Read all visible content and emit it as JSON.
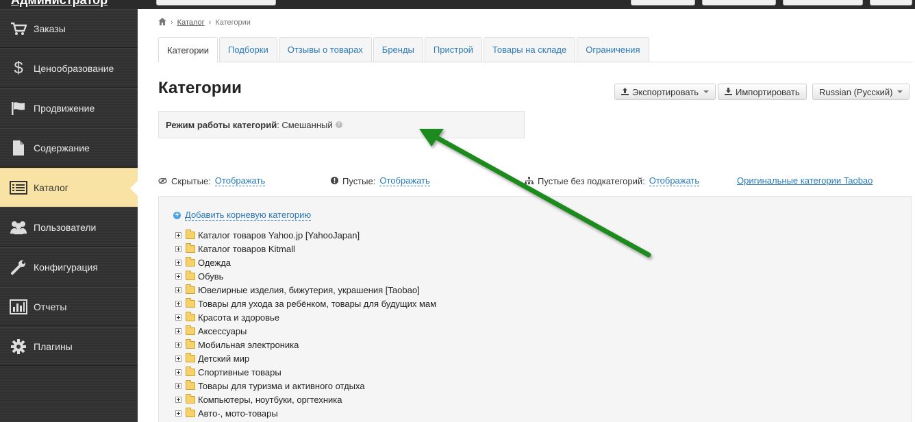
{
  "topbar": {
    "logo": "Администратор"
  },
  "sidebar": {
    "items": [
      {
        "label": "Заказы",
        "icon": "cart-icon"
      },
      {
        "label": "Ценообразование",
        "icon": "dollar-icon"
      },
      {
        "label": "Продвижение",
        "icon": "flag-icon"
      },
      {
        "label": "Содержание",
        "icon": "document-icon"
      },
      {
        "label": "Каталог",
        "icon": "list-icon",
        "active": true
      },
      {
        "label": "Пользователи",
        "icon": "users-icon"
      },
      {
        "label": "Конфигурация",
        "icon": "wrench-icon"
      },
      {
        "label": "Отчеты",
        "icon": "bar-chart-icon"
      },
      {
        "label": "Плагины",
        "icon": "gear-icon"
      }
    ]
  },
  "breadcrumb": {
    "home_icon": "home-icon",
    "catalog": "Каталог",
    "current": "Категории",
    "sep": "›"
  },
  "tabs": [
    {
      "label": "Категории",
      "active": true
    },
    {
      "label": "Подборки"
    },
    {
      "label": "Отзывы о товарах"
    },
    {
      "label": "Бренды"
    },
    {
      "label": "Пристрой"
    },
    {
      "label": "Товары на складе"
    },
    {
      "label": "Ограничения"
    }
  ],
  "page": {
    "title": "Категории",
    "export_label": "Экспортировать",
    "import_label": "Импортировать",
    "language_label": "Russian (Русский)"
  },
  "mode": {
    "label": "Режим работы категорий",
    "value": "Смешанный"
  },
  "filters": {
    "hidden_label": "Скрытые:",
    "hidden_value": "Отображать",
    "empty_label": "Пустые:",
    "empty_value": "Отображать",
    "empty_nosub_label": "Пустые без подкатегорий:",
    "empty_nosub_value": "Отображать",
    "taobao_link": "Оригинальные категории Taobao"
  },
  "tree": {
    "add_root": "Добавить корневую категорию",
    "categories": [
      "Каталог товаров Yahoo.jp [YahooJapan]",
      "Каталог товаров Kitmall",
      "Одежда",
      "Обувь",
      "Ювелирные изделия, бижутерия, украшения [Taobao]",
      "Товары для ухода за ребёнком, товары для будущих мам",
      "Красота и здоровье",
      "Аксессуары",
      "Мобильная электроника",
      "Детский мир",
      "Спортивные товары",
      "Товары для туризма и активного отдыха",
      "Компьютеры, ноутбуки, оргтехника",
      "Авто-, мото-товары"
    ]
  },
  "colors": {
    "accent": "#2a7ab8",
    "active_nav": "#f8e3a4",
    "arrow": "#1f8a1f"
  }
}
